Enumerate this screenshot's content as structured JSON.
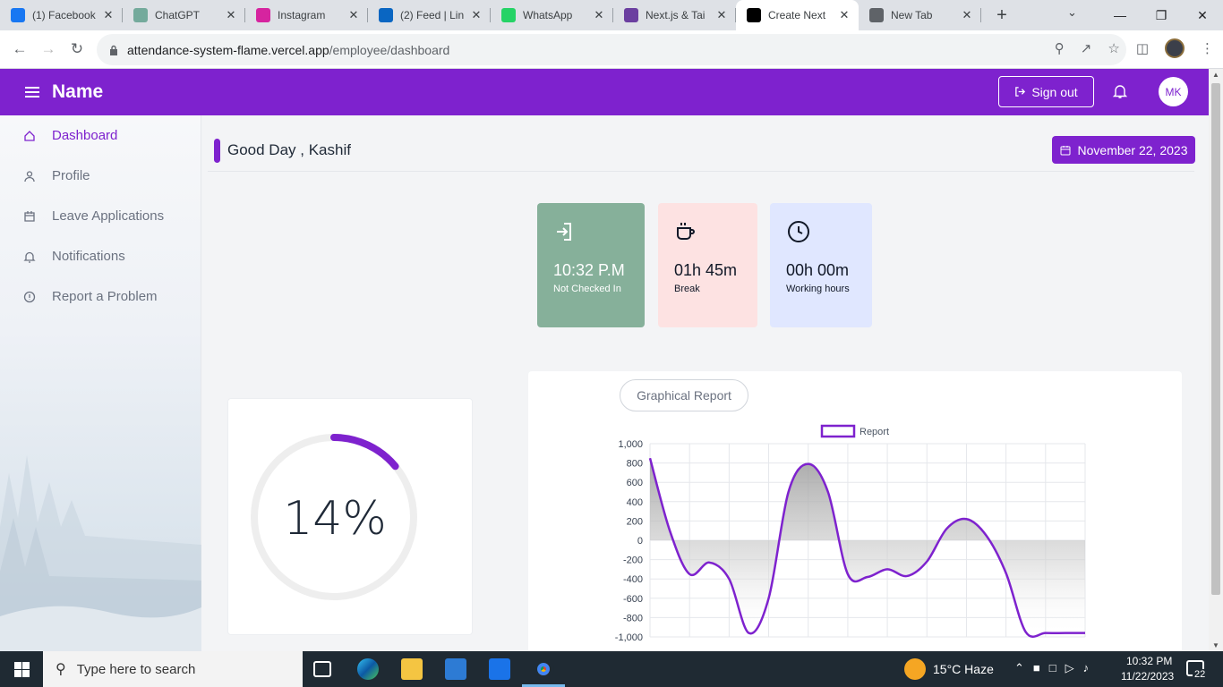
{
  "browser": {
    "tabs": [
      {
        "title": "(1) Facebook",
        "icon": "facebook-icon",
        "color": "#1877f2"
      },
      {
        "title": "ChatGPT",
        "icon": "chatgpt-icon",
        "color": "#74aa9c"
      },
      {
        "title": "Instagram",
        "icon": "instagram-icon",
        "color": "#d6249f"
      },
      {
        "title": "(2) Feed | Lin",
        "icon": "linkedin-icon",
        "color": "#0a66c2"
      },
      {
        "title": "WhatsApp",
        "icon": "whatsapp-icon",
        "color": "#25d366"
      },
      {
        "title": "Next.js & Tai",
        "icon": "nextjs-icon",
        "color": "#6b3fa0"
      },
      {
        "title": "Create Next",
        "icon": "vercel-icon",
        "color": "#000000",
        "active": true
      },
      {
        "title": "New Tab",
        "icon": "chrome-icon",
        "color": "#5f6368"
      }
    ],
    "url_host": "attendance-system-flame.vercel.app",
    "url_path": "/employee/dashboard"
  },
  "app": {
    "brand": "Name",
    "signout_label": "Sign out",
    "avatar_initials": "MK",
    "accent": "#7e22ce"
  },
  "sidebar": {
    "items": [
      {
        "label": "Dashboard",
        "icon": "home-icon",
        "active": true
      },
      {
        "label": "Profile",
        "icon": "user-icon"
      },
      {
        "label": "Leave Applications",
        "icon": "calendar-icon"
      },
      {
        "label": "Notifications",
        "icon": "bell-icon"
      },
      {
        "label": "Report a Problem",
        "icon": "alert-circle-icon"
      }
    ]
  },
  "dashboard": {
    "greeting": "Good Day , Kashif",
    "date": "November 22, 2023",
    "stats": [
      {
        "value": "10:32 P.M",
        "label": "Not Checked In",
        "icon": "login-icon",
        "bg": "#86b09a",
        "fg": "#ffffff"
      },
      {
        "value": "01h 45m",
        "label": "Break",
        "icon": "coffee-icon",
        "bg": "#fde2e2",
        "fg": "#111827"
      },
      {
        "value": "00h 00m",
        "label": "Working hours",
        "icon": "clock-icon",
        "bg": "#e0e7ff",
        "fg": "#111827"
      }
    ],
    "progress": {
      "text": "14%",
      "value": 0.14
    },
    "chart_button": "Graphical Report"
  },
  "chart_data": {
    "type": "area",
    "title": "",
    "legend": [
      "Report"
    ],
    "legend_position": "top",
    "ylim": [
      -1000,
      1000
    ],
    "y_ticks": [
      "1,000",
      "800",
      "600",
      "400",
      "200",
      "0",
      "-200",
      "-400",
      "-600",
      "-800",
      "-1,000"
    ],
    "series": [
      {
        "name": "Report",
        "x": [
          0,
          0.5,
          1,
          1.5,
          2,
          2.5,
          3,
          3.5,
          4,
          4.5,
          5,
          5.5,
          6,
          6.5,
          7,
          7.5,
          8,
          8.5,
          9,
          9.5,
          10,
          10.5,
          11
        ],
        "values": [
          850,
          100,
          -350,
          -230,
          -400,
          -960,
          -600,
          500,
          790,
          500,
          -350,
          -380,
          -300,
          -370,
          -220,
          120,
          220,
          50,
          -340,
          -950,
          -960,
          -960,
          -960
        ]
      }
    ],
    "grid": true,
    "line_color": "#7e22ce"
  },
  "taskbar": {
    "search_placeholder": "Type here to search",
    "weather": "15°C  Haze",
    "time": "10:32 PM",
    "date": "11/22/2023",
    "notifications": "22"
  }
}
